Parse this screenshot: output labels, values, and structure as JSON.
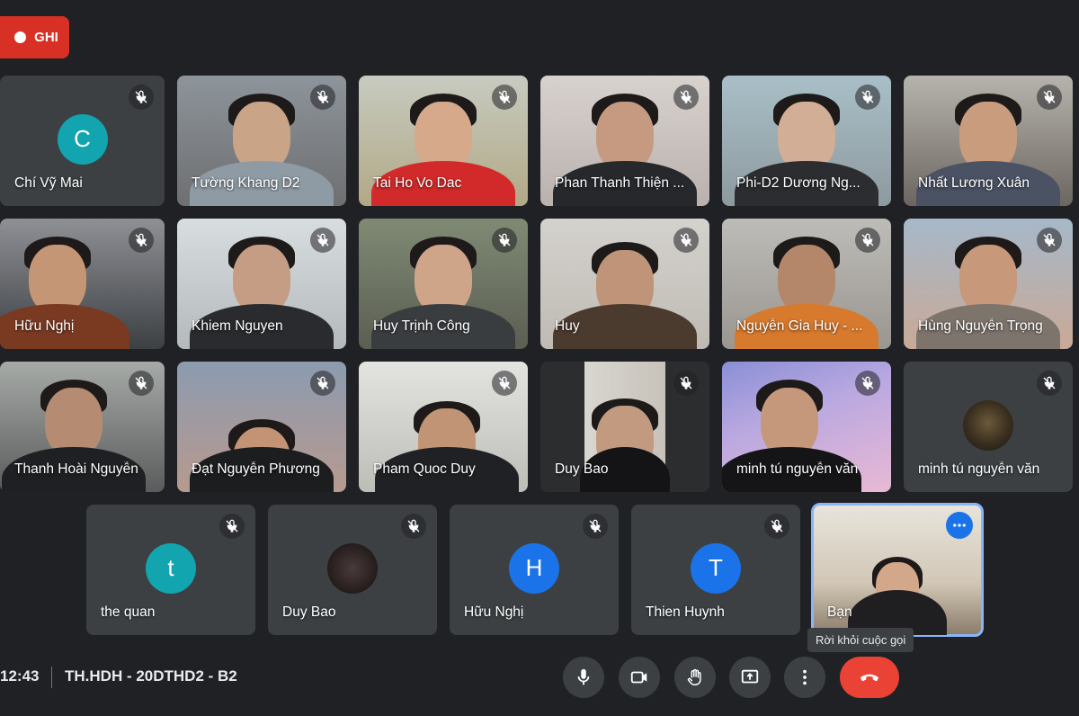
{
  "recording": {
    "label": "GHI"
  },
  "participants_row1": [
    {
      "name": "Chí Vỹ Mai",
      "type": "avatar",
      "initial": "C",
      "color": "#12a4af"
    },
    {
      "name": "Tường Khang D2",
      "type": "video"
    },
    {
      "name": "Tai Ho Vo Dac",
      "type": "video"
    },
    {
      "name": "Phan Thanh Thiện ...",
      "type": "video"
    },
    {
      "name": "Phi-D2 Dương Ng...",
      "type": "video"
    },
    {
      "name": "Nhất Lương Xuân",
      "type": "video"
    }
  ],
  "participants_row2": [
    {
      "name": "Hữu Nghị",
      "type": "video"
    },
    {
      "name": "Khiem Nguyen",
      "type": "video"
    },
    {
      "name": "Huy Trịnh Công",
      "type": "video"
    },
    {
      "name": "Huy",
      "type": "video"
    },
    {
      "name": "Nguyễn Gia Huy - ...",
      "type": "video"
    },
    {
      "name": "Hùng Nguyễn Trọng",
      "type": "video"
    }
  ],
  "participants_row3": [
    {
      "name": "Thanh Hoài Nguyễn",
      "type": "video"
    },
    {
      "name": "Đạt Nguyễn Phương",
      "type": "video"
    },
    {
      "name": "Pham Quoc Duy",
      "type": "video"
    },
    {
      "name": "Duy Bao",
      "type": "video"
    },
    {
      "name": "minh tú nguyễn văn",
      "type": "video"
    },
    {
      "name": "minh tú nguyễn văn",
      "type": "photo-avatar"
    }
  ],
  "participants_row4": [
    {
      "name": "the quan",
      "type": "avatar",
      "initial": "t",
      "color": "#12a4af"
    },
    {
      "name": "Duy Bao",
      "type": "photo-avatar"
    },
    {
      "name": "Hữu Nghị",
      "type": "avatar",
      "initial": "H",
      "color": "#1a73e8"
    },
    {
      "name": "Thien Huynh",
      "type": "avatar",
      "initial": "T",
      "color": "#1a73e8"
    },
    {
      "name": "Bạn",
      "type": "video-self"
    }
  ],
  "tooltip": "Rời khỏi cuộc gọi",
  "bottom": {
    "time": "12:43",
    "meeting_name": "TH.HDH - 20DTHD2 - B2"
  },
  "colors": {
    "background": "#202124",
    "tile": "#3c4043",
    "accent": "#1a73e8",
    "hangup": "#ea4335",
    "record": "#d93025"
  }
}
